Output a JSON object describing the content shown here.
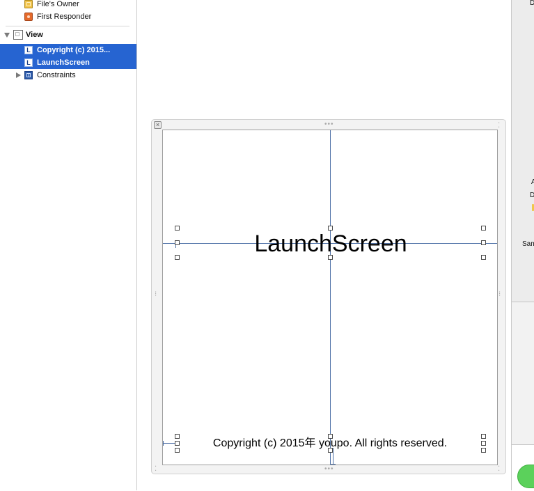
{
  "outline": {
    "files_owner": "File's Owner",
    "first_responder": "First Responder",
    "view": "View",
    "item_copyright": "Copyright (c) 2015...",
    "item_launchscreen": "LaunchScreen",
    "constraints": "Constraints",
    "label_icon_letter": "L"
  },
  "canvas": {
    "title_label": "LaunchScreen",
    "copyright_label": "Copyright (c) 2015年 youpo. All rights reserved."
  },
  "inspector": {
    "text_d1": "D",
    "text_a": "A",
    "text_d2": "D",
    "text_sam": "Sam"
  },
  "colors": {
    "selection": "#2664d1",
    "guide": "#4b6ea5",
    "toggle_green": "#5bd15b"
  }
}
